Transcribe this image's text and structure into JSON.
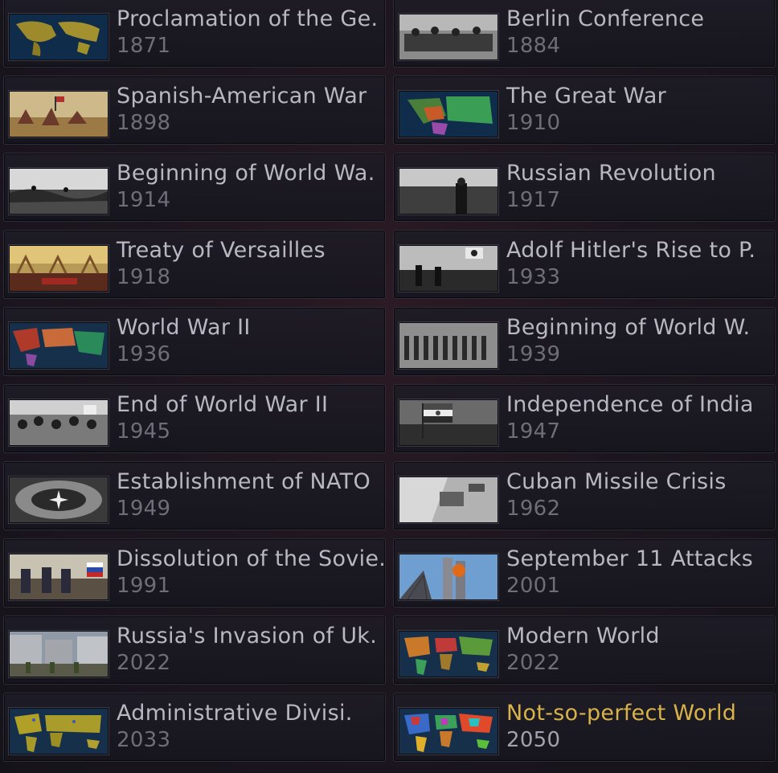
{
  "scenarios": [
    {
      "title": "Proclamation of the Ge.",
      "year": "1871",
      "thumb": "map-thumbnail-icon"
    },
    {
      "title": "Berlin Conference",
      "year": "1884",
      "thumb": "photo-thumbnail-icon"
    },
    {
      "title": "Spanish-American War",
      "year": "1898",
      "thumb": "painting-thumbnail-icon"
    },
    {
      "title": "The Great War",
      "year": "1910",
      "thumb": "map-thumbnail-icon"
    },
    {
      "title": "Beginning of World Wa.",
      "year": "1914",
      "thumb": "photo-thumbnail-icon"
    },
    {
      "title": "Russian Revolution",
      "year": "1917",
      "thumb": "photo-thumbnail-icon"
    },
    {
      "title": "Treaty of Versailles",
      "year": "1918",
      "thumb": "painting-thumbnail-icon"
    },
    {
      "title": "Adolf Hitler's Rise to P.",
      "year": "1933",
      "thumb": "photo-thumbnail-icon"
    },
    {
      "title": "World War II",
      "year": "1936",
      "thumb": "map-thumbnail-icon"
    },
    {
      "title": "Beginning of World W.",
      "year": "1939",
      "thumb": "photo-thumbnail-icon"
    },
    {
      "title": "End of World War II",
      "year": "1945",
      "thumb": "photo-thumbnail-icon"
    },
    {
      "title": "Independence of India",
      "year": "1947",
      "thumb": "photo-thumbnail-icon"
    },
    {
      "title": "Establishment of NATO",
      "year": "1949",
      "thumb": "photo-thumbnail-icon"
    },
    {
      "title": "Cuban Missile Crisis",
      "year": "1962",
      "thumb": "photo-thumbnail-icon"
    },
    {
      "title": "Dissolution of the Sovie.",
      "year": "1991",
      "thumb": "photo-thumbnail-icon"
    },
    {
      "title": "September 11 Attacks",
      "year": "2001",
      "thumb": "photo-thumbnail-icon"
    },
    {
      "title": "Russia's Invasion of Uk.",
      "year": "2022",
      "thumb": "photo-thumbnail-icon"
    },
    {
      "title": "Modern World",
      "year": "2022",
      "thumb": "map-thumbnail-icon"
    },
    {
      "title": "Administrative Divisi.",
      "year": "2033",
      "thumb": "map-thumbnail-icon"
    },
    {
      "title": "Not-so-perfect World",
      "year": "2050",
      "thumb": "map-thumbnail-icon",
      "selected": true
    }
  ],
  "colors": {
    "title_text": "#b9b8c2",
    "year_text": "#6e6d78",
    "selected_title": "#d9b24a",
    "card_bg": "#1e1c26"
  }
}
